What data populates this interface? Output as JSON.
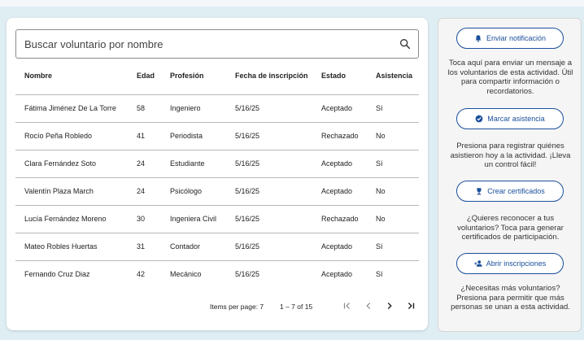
{
  "search": {
    "placeholder": "Buscar voluntario por nombre"
  },
  "table": {
    "columns": [
      "Nombre",
      "Edad",
      "Profesión",
      "Fecha de inscripción",
      "Estado",
      "Asistencia"
    ],
    "rows": [
      [
        "Fátima Jiménez De La Torre",
        "58",
        "Ingeniero",
        "5/16/25",
        "Aceptado",
        "Sí"
      ],
      [
        "Rocío Peña Robledo",
        "41",
        "Periodista",
        "5/16/25",
        "Rechazado",
        "No"
      ],
      [
        "Clara Fernández Soto",
        "24",
        "Estudiante",
        "5/16/25",
        "Aceptado",
        "Sí"
      ],
      [
        "Valentín Plaza March",
        "24",
        "Psicólogo",
        "5/16/25",
        "Aceptado",
        "No"
      ],
      [
        "Lucía Fernández Moreno",
        "30",
        "Ingeniera Civil",
        "5/16/25",
        "Rechazado",
        "No"
      ],
      [
        "Mateo Robles Huertas",
        "31",
        "Contador",
        "5/16/25",
        "Aceptado",
        "Sí"
      ],
      [
        "Fernando Cruz Diaz",
        "42",
        "Mecánico",
        "5/16/25",
        "Aceptado",
        "Sí"
      ]
    ]
  },
  "pager": {
    "items_per_page": "Items per page: 7",
    "range": "1 – 7 of 15"
  },
  "actions": [
    {
      "label": "Enviar notificación",
      "icon": "bell-icon",
      "description": "Toca aquí para enviar un mensaje a los voluntarios de esta actividad. Útil para compartir información o recordatorios."
    },
    {
      "label": "Marcar asistencia",
      "icon": "check-circle-icon",
      "description": "Presiona para registrar quiénes asistieron hoy a la actividad. ¡Lleva un control fácil!"
    },
    {
      "label": "Crear certificados",
      "icon": "trophy-icon",
      "description": "¿Quieres reconocer a tus voluntarios? Toca para generar certificados de participación."
    },
    {
      "label": "Abrir inscripciones",
      "icon": "person-add-icon",
      "description": "¿Necesitas más voluntarios? Presiona para permitir que más personas se unan a esta actividad."
    }
  ],
  "colors": {
    "accent": "#1b4f9c",
    "background": "#dfeef3"
  }
}
